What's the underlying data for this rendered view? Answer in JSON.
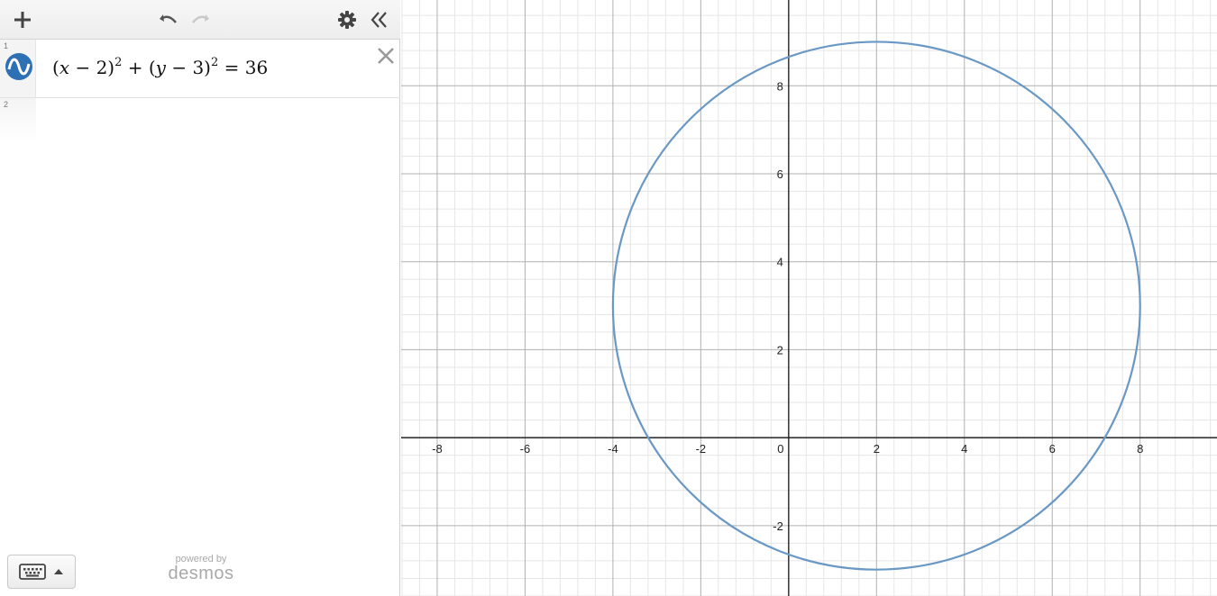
{
  "toolbar": {
    "add_icon": "plus-icon",
    "undo_icon": "undo-icon",
    "redo_icon": "redo-icon",
    "settings_icon": "gear-icon",
    "collapse_icon": "double-chevron-left-icon"
  },
  "expressions": [
    {
      "index": "1",
      "latex": "(x - 2)^2 + (y - 3)^2 = 36",
      "parts": {
        "open1": "(",
        "x": "x",
        "minus1": " − 2)",
        "exp1": "2",
        "plus": " + (",
        "y": "y",
        "minus2": " − 3)",
        "exp2": "2",
        "equals": " = 36"
      },
      "color": "#4f89c0"
    },
    {
      "index": "2"
    }
  ],
  "footer": {
    "powered_by": "powered by",
    "brand": "desmos"
  },
  "graph": {
    "x_range": [
      -8.82,
      9.75
    ],
    "y_range": [
      -3.6,
      9.95
    ],
    "circle": {
      "h": 2,
      "k": 3,
      "r": 6
    },
    "x_ticks": [
      "-8",
      "-6",
      "-4",
      "-2",
      "0",
      "2",
      "4",
      "6",
      "8"
    ],
    "y_ticks": [
      "-2",
      "2",
      "4",
      "6",
      "8"
    ],
    "curve_color": "#6a98c4",
    "grid_major_color": "#b0b0b0",
    "grid_minor_color": "#e6e6e6",
    "axis_color": "#222222"
  }
}
